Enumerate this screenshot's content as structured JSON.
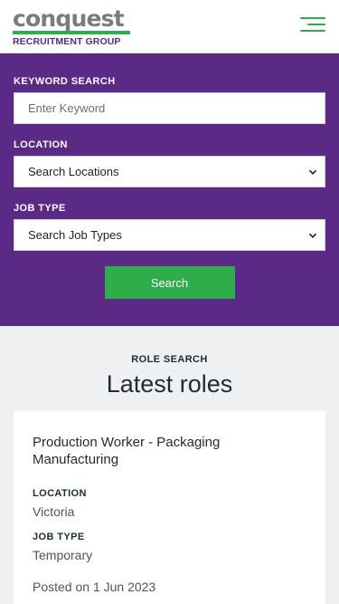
{
  "header": {
    "logo_word": "conquest",
    "logo_sub": "RECRUITMENT GROUP",
    "menu_icon": "hamburger-menu-icon",
    "brand_green": "#2fad4a",
    "brand_purple": "#5b2a86"
  },
  "search": {
    "keyword_label": "KEYWORD SEARCH",
    "keyword_placeholder": "Enter Keyword",
    "keyword_value": "",
    "location_label": "LOCATION",
    "location_value": "Search Locations",
    "jobtype_label": "JOB TYPE",
    "jobtype_value": "Search Job Types",
    "button_label": "Search"
  },
  "roles": {
    "kicker": "ROLE SEARCH",
    "title": "Latest roles",
    "items": [
      {
        "title": "Production Worker - Packaging Manufacturing",
        "location_label": "LOCATION",
        "location": "Victoria",
        "jobtype_label": "JOB TYPE",
        "jobtype": "Temporary",
        "posted": "Posted on 1 Jun 2023"
      }
    ]
  }
}
